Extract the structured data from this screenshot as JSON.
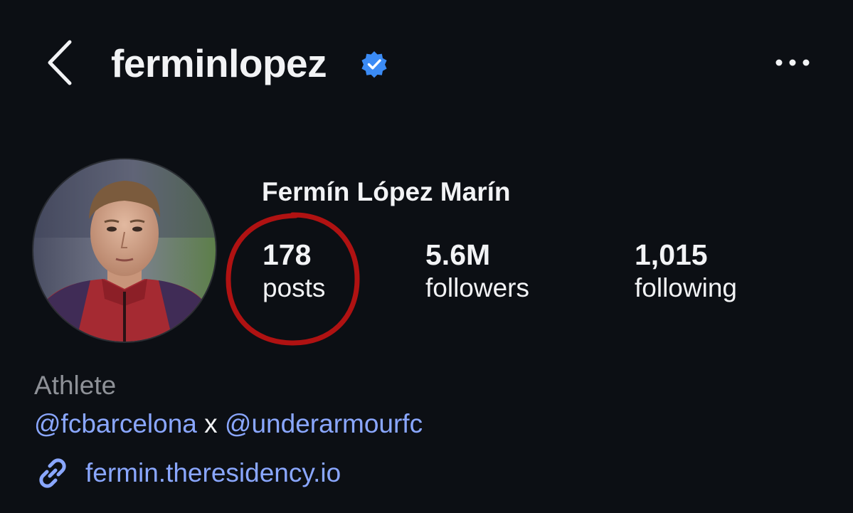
{
  "header": {
    "back_icon": "chevron-left-icon",
    "username": "ferminlopez",
    "verified_icon": "verified-badge-icon",
    "more_icon": "more-horizontal-icon"
  },
  "profile": {
    "full_name": "Fermín López Marín",
    "avatar_icon": "profile-photo"
  },
  "stats": [
    {
      "value": "178",
      "label": "posts"
    },
    {
      "value": "5.6M",
      "label": "followers"
    },
    {
      "value": "1,015",
      "label": "following"
    }
  ],
  "annotation": {
    "color": "#b01212"
  },
  "bio": {
    "category": "Athlete",
    "mention_1": "@fcbarcelona",
    "separator": "x",
    "mention_2": "@underarmourfc",
    "link_icon": "link-icon",
    "link": "fermin.theresidency.io"
  },
  "colors": {
    "background": "#0c0f14",
    "text": "#f2f3f5",
    "muted": "#8e9197",
    "link": "#8aa7ff",
    "verified": "#3b8bf5"
  }
}
